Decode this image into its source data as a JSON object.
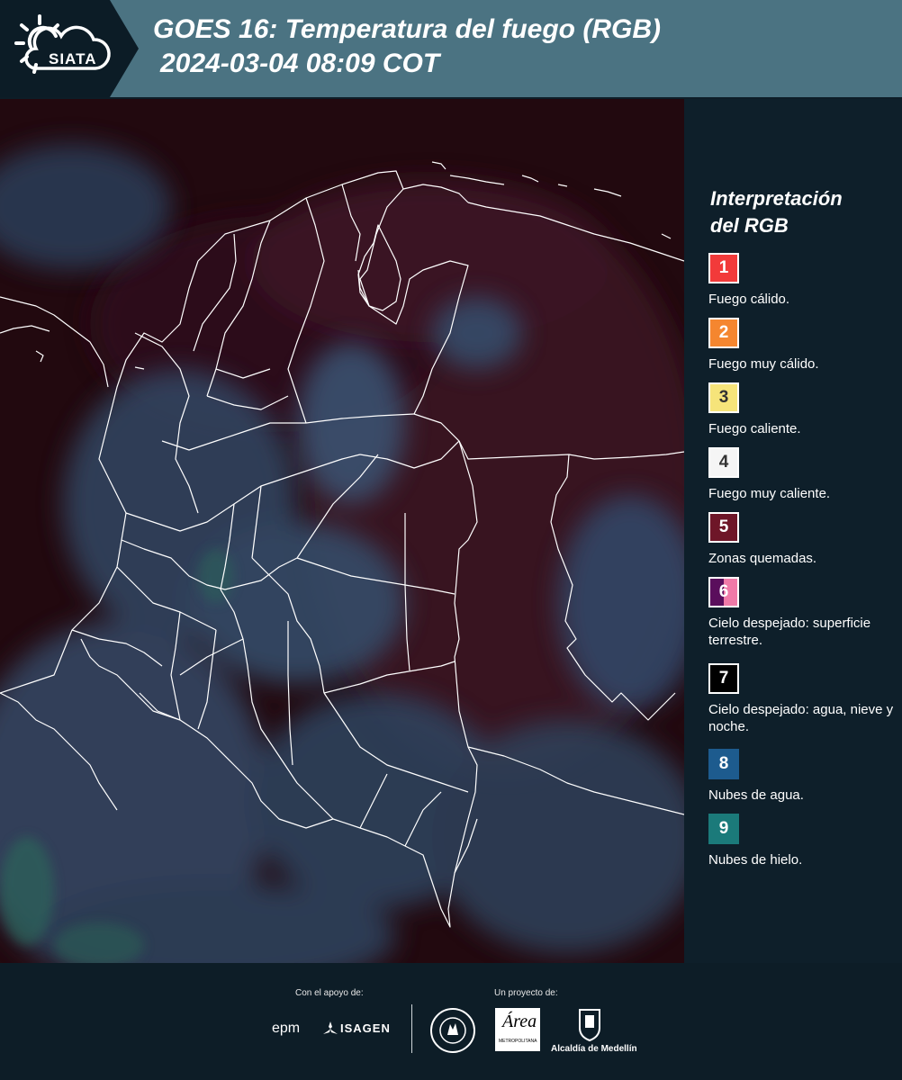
{
  "header": {
    "logo_text": "SIATA",
    "title": "GOES 16: Temperatura del fuego (RGB)",
    "subtitle": "2024-03-04 08:09 COT",
    "band_color": "#4b7382",
    "dark_color": "#0c1c26"
  },
  "legend": {
    "title_line1": "Interpretación",
    "title_line2": "del RGB",
    "items": [
      {
        "num": "1",
        "label": "Fuego cálido.",
        "color": "#f23a3a",
        "text_color": "#ffffff"
      },
      {
        "num": "2",
        "label": "Fuego muy cálido.",
        "color": "#f5862f",
        "text_color": "#ffffff"
      },
      {
        "num": "3",
        "label": "Fuego caliente.",
        "color": "#f6e47a",
        "text_color": "#333333"
      },
      {
        "num": "4",
        "label": "Fuego muy caliente.",
        "color": "#f5f5f5",
        "text_color": "#333333"
      },
      {
        "num": "5",
        "label": "Zonas quemadas.",
        "color": "#6e1628",
        "text_color": "#ffffff"
      },
      {
        "num": "6",
        "label": "Cielo despejado: superficie terrestre.",
        "color": "#5a0e5c",
        "color2": "#f07aa8",
        "text_color": "#ffffff"
      },
      {
        "num": "7",
        "label": "Cielo despejado: agua, nieve y noche.",
        "color": "#000000",
        "text_color": "#ffffff"
      },
      {
        "num": "8",
        "label": "Nubes de agua.",
        "color": "#1d5b8e",
        "text_color": "#ffffff"
      },
      {
        "num": "9",
        "label": "Nubes de hielo.",
        "color": "#1b7a7a",
        "text_color": "#ffffff"
      }
    ]
  },
  "footer": {
    "support_label": "Con el apoyo de:",
    "project_label": "Un proyecto de:",
    "sponsor_1": "epm",
    "sponsor_2": "ISAGEN",
    "area_name": "Área",
    "area_sub": "METROPOLITANA",
    "alcaldia": "Alcaldía de Medellín"
  },
  "map": {
    "land_color": "#2a0d18",
    "cloud_color": "#37516e",
    "border_color": "#ffffff"
  }
}
